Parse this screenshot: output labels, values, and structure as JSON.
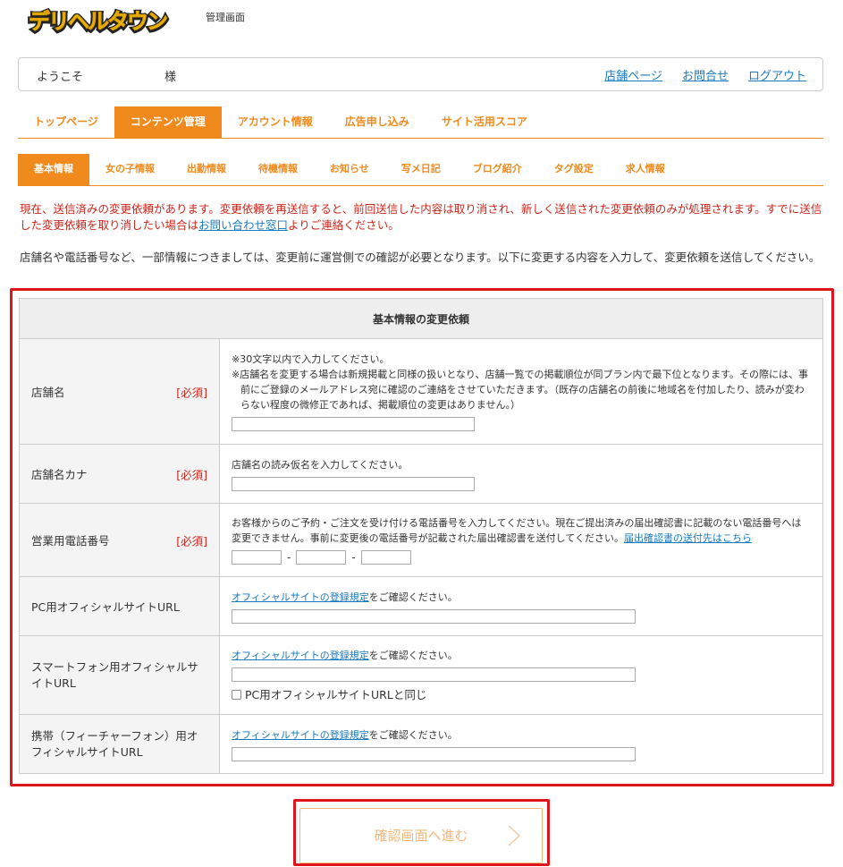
{
  "header": {
    "logo_text": "デリヘルタウン",
    "admin_title": "管理画面"
  },
  "welcome": {
    "greeting": "ようこそ",
    "suffix": "様",
    "links": [
      "店舗ページ",
      "お問合せ",
      "ログアウト"
    ]
  },
  "main_tabs": [
    {
      "label": "トップページ",
      "active": false
    },
    {
      "label": "コンテンツ管理",
      "active": true
    },
    {
      "label": "アカウント情報",
      "active": false
    },
    {
      "label": "広告申し込み",
      "active": false
    },
    {
      "label": "サイト活用スコア",
      "active": false
    }
  ],
  "sub_tabs": [
    {
      "label": "基本情報",
      "active": true
    },
    {
      "label": "女の子情報",
      "active": false
    },
    {
      "label": "出勤情報",
      "active": false
    },
    {
      "label": "待機情報",
      "active": false
    },
    {
      "label": "お知らせ",
      "active": false
    },
    {
      "label": "写メ日記",
      "active": false
    },
    {
      "label": "ブログ紹介",
      "active": false
    },
    {
      "label": "タグ設定",
      "active": false
    },
    {
      "label": "求人情報",
      "active": false
    }
  ],
  "notice": {
    "red_pre": "現在、送信済みの変更依頼があります。変更依頼を再送信すると、前回送信した内容は取り消され、新しく送信された変更依頼のみが処理されます。すでに送信した変更依頼を取り消したい場合は",
    "red_link": "お問い合わせ窓口",
    "red_post": "よりご連絡ください。",
    "black": "店舗名や電話番号など、一部情報につきましては、変更前に運営側での確認が必要となります。以下に変更する内容を入力して、変更依頼を送信してください。"
  },
  "form": {
    "caption": "基本情報の変更依頼",
    "required_label": "[必須]",
    "rows": {
      "shop_name": {
        "label": "店舗名",
        "note1": "※30文字以内で入力してください。",
        "note2": "※店舗名を変更する場合は新規掲載と同様の扱いとなり、店舗一覧での掲載順位が同プラン内で最下位となります。その際には、事前にご登録のメールアドレス宛に確認のご連絡をさせていただきます。（既存の店舗名の前後に地域名を付加したり、読みが変わらない程度の微修正であれば、掲載順位の変更はありません。）"
      },
      "shop_kana": {
        "label": "店舗名カナ",
        "note": "店舗名の読み仮名を入力してください。"
      },
      "phone": {
        "label": "営業用電話番号",
        "note": "お客様からのご予約・ご注文を受け付ける電話番号を入力してください。現在ご提出済みの届出確認書に記載のない電話番号へは変更できません。事前に変更後の電話番号が記載された届出確認書を送付してください。",
        "link": "届出確認書の送付先はこちら",
        "separator": "-"
      },
      "pc_url": {
        "label": "PC用オフィシャルサイトURL",
        "link": "オフィシャルサイトの登録規定",
        "note_suffix": "をご確認ください。"
      },
      "sp_url": {
        "label": "スマートフォン用オフィシャルサイトURL",
        "link": "オフィシャルサイトの登録規定",
        "note_suffix": "をご確認ください。",
        "checkbox_label": "PC用オフィシャルサイトURLと同じ"
      },
      "mobile_url": {
        "label": "携帯（フィーチャーフォン）用オフィシャルサイトURL",
        "link": "オフィシャルサイトの登録規定",
        "note_suffix": "をご確認ください。"
      }
    }
  },
  "confirm_button": "確認画面へ進む",
  "colors": {
    "accent": "#f08a1c",
    "alert_red": "#d0241b",
    "highlight_frame": "#e0151b",
    "link": "#1a7bbf"
  }
}
